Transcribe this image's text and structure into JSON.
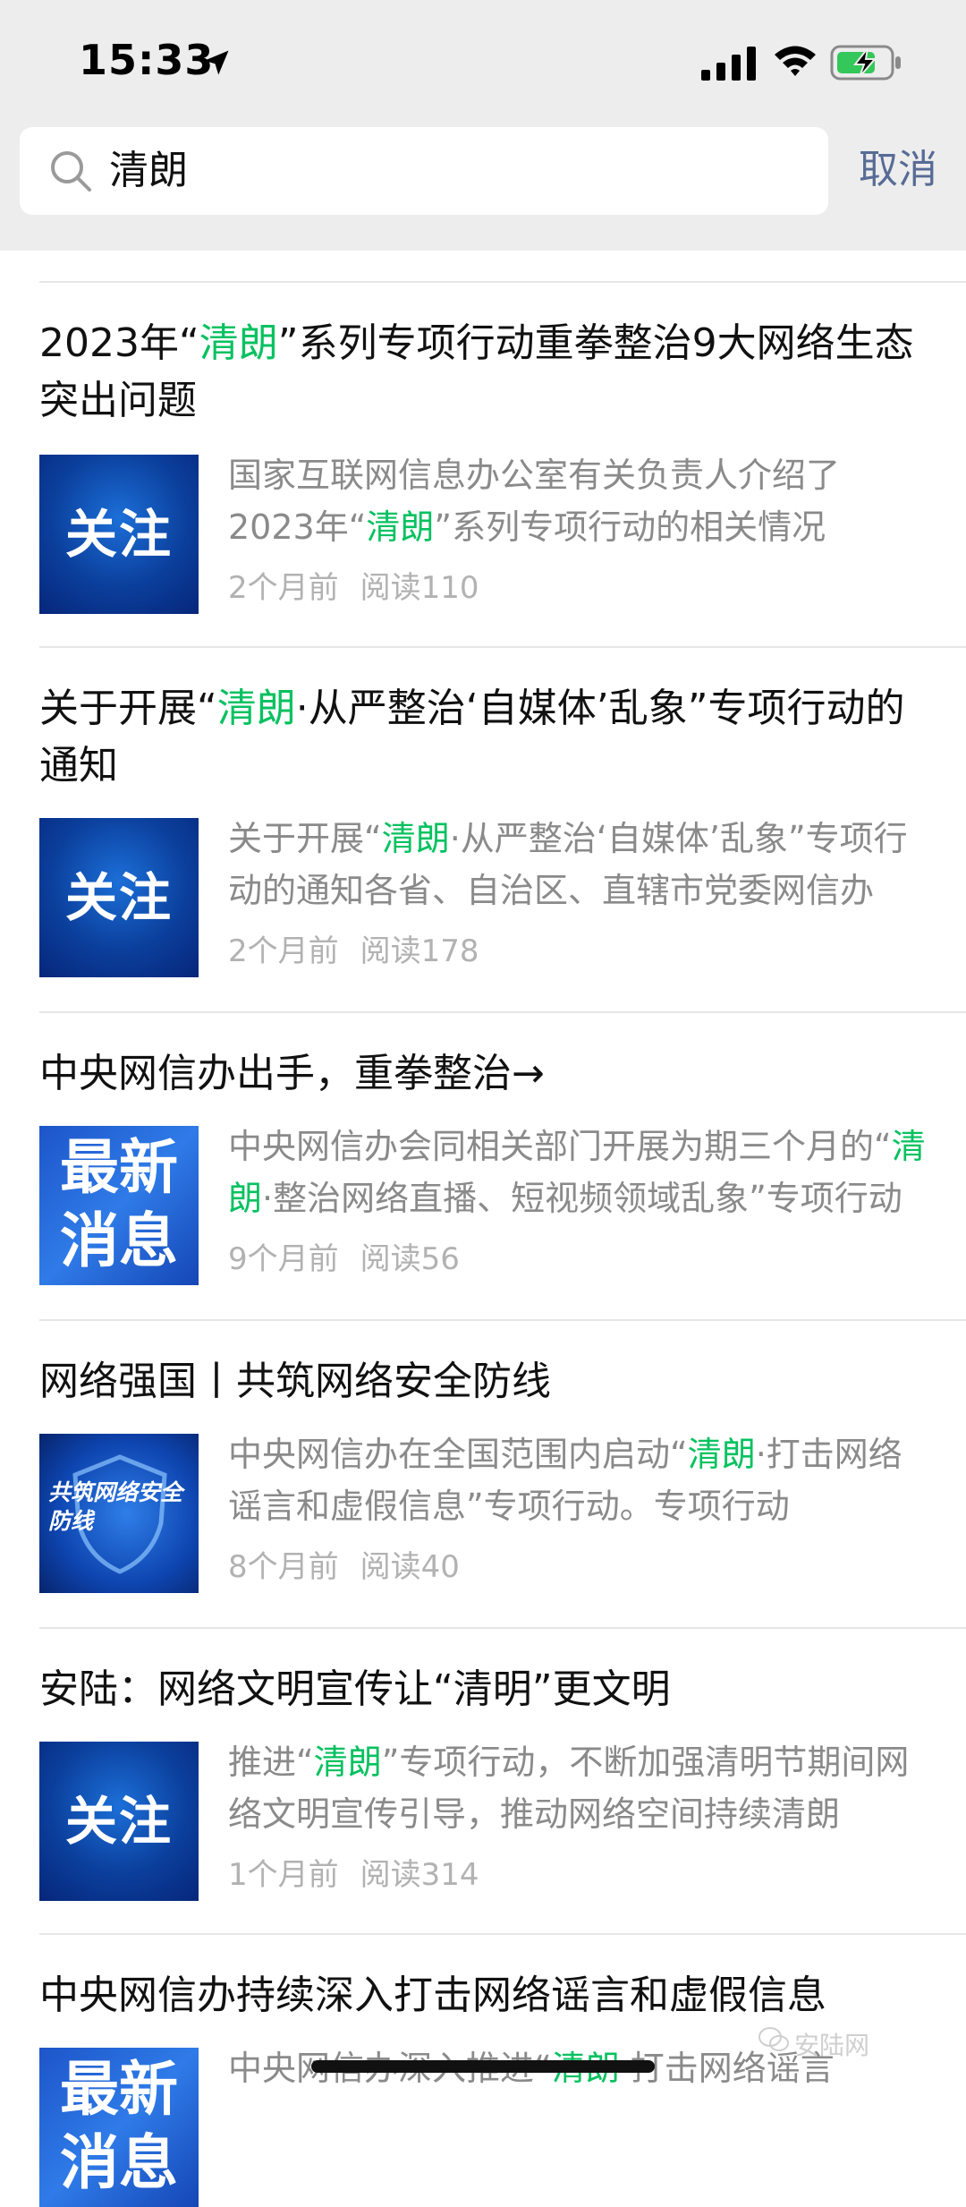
{
  "status_bar": {
    "time": "15:33"
  },
  "search": {
    "query": "清朗",
    "cancel_label": "取消"
  },
  "articles": [
    {
      "title": [
        "2023年“",
        "清朗",
        "”系列专项行动重拳整治9大网络生态突出问题"
      ],
      "thumb_text": "关注",
      "desc": [
        "国家互联网信息办公室有关负责人介绍了2023年“",
        "清朗",
        "”系列专项行动的相关情况"
      ],
      "time": "2个月前",
      "reads": "阅读110"
    },
    {
      "title": [
        "关于开展“",
        "清朗",
        "·从严整治‘自媒体’乱象”专项行动的通知"
      ],
      "thumb_text": "关注",
      "desc": [
        "关于开展“",
        "清朗",
        "·从严整治‘自媒体’乱象”专项行动的通知各省、自治区、直辖市党委网信办"
      ],
      "time": "2个月前",
      "reads": "阅读178"
    },
    {
      "title": [
        "中央网信办出手，重拳整治→",
        "",
        ""
      ],
      "thumb_text": "最新消息",
      "desc": [
        "中央网信办会同相关部门开展为期三个月的“",
        "清朗",
        "·整治网络直播、短视频领域乱象”专项行动"
      ],
      "time": "9个月前",
      "reads": "阅读56"
    },
    {
      "title": [
        "网络强国丨共筑网络安全防线",
        "",
        ""
      ],
      "thumb_text": "共筑网络安全防线",
      "desc": [
        "中央网信办在全国范围内启动“",
        "清朗",
        "·打击网络谣言和虚假信息”专项行动。专项行动"
      ],
      "time": "8个月前",
      "reads": "阅读40"
    },
    {
      "title": [
        "安陆：网络文明宣传让“清明”更文明",
        "",
        ""
      ],
      "thumb_text": "关注",
      "desc": [
        "推进“",
        "清朗",
        "”专项行动，不断加强清明节期间网络文明宣传引导，推动网络空间持续清朗"
      ],
      "time": "1个月前",
      "reads": "阅读314"
    },
    {
      "title": [
        "中央网信办持续深入打击网络谣言和虚假信息",
        "",
        ""
      ],
      "thumb_text": "最新消息",
      "desc": [
        "中央网信办深入推进“",
        "清朗",
        "·打击网络谣言"
      ],
      "time": "",
      "reads": ""
    }
  ],
  "watermark": "安陆网",
  "colors": {
    "highlight": "#07c160",
    "cancel": "#576b95",
    "meta": "#b2b2b2"
  }
}
